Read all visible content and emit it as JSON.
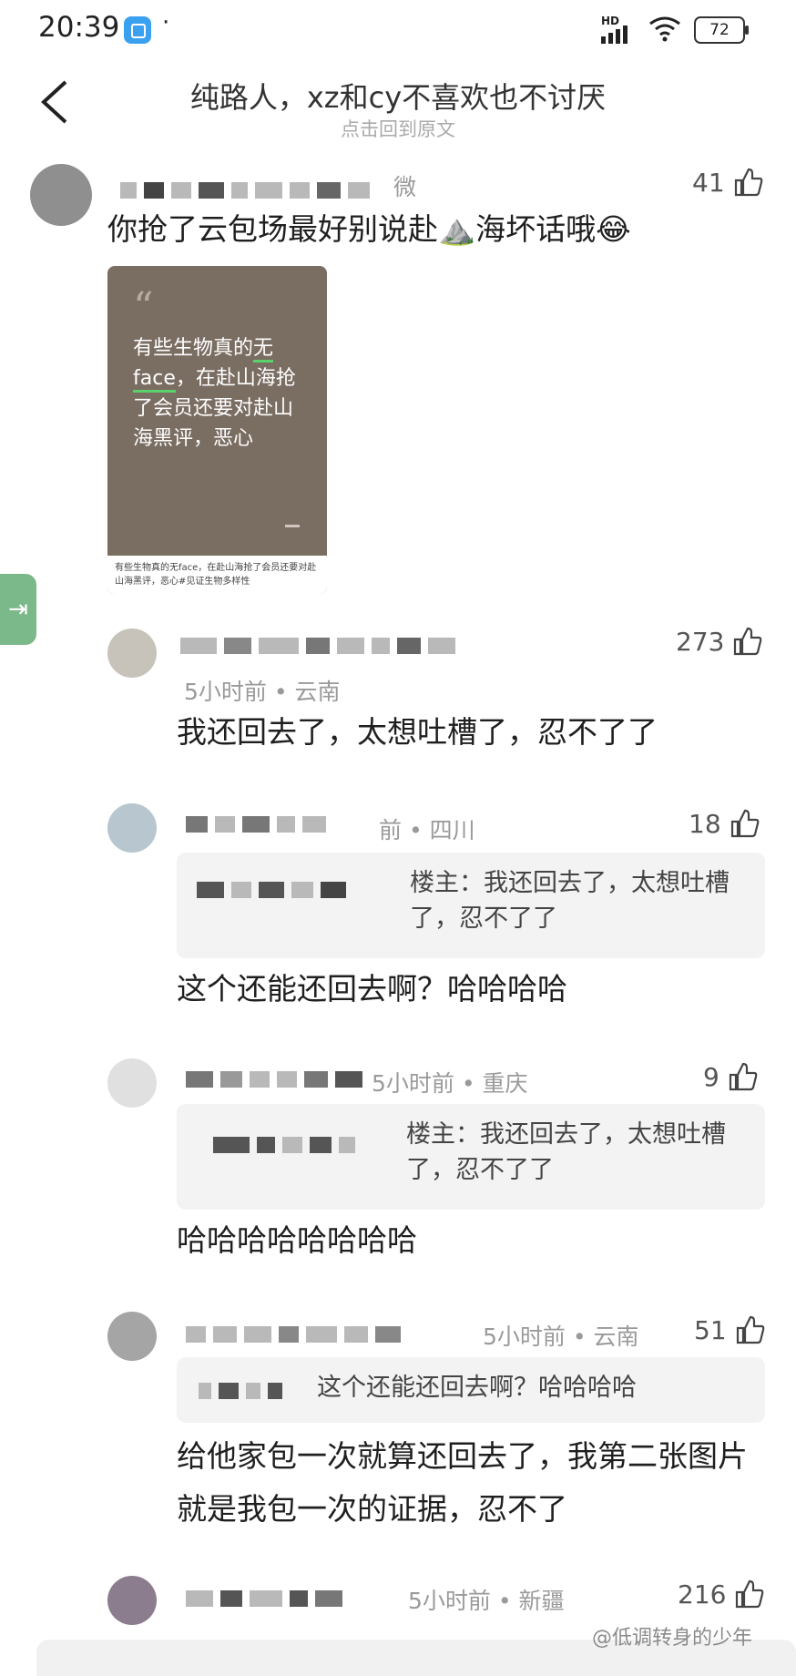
{
  "status_bar": {
    "time": "20:39",
    "dot": "·",
    "hd": "HD",
    "battery": "72"
  },
  "header": {
    "title": "纯路人，xz和cy不喜欢也不讨厌",
    "subtitle": "点击回到原文"
  },
  "main_comment": {
    "name_tail": "微",
    "likes": "41",
    "text": "你抢了云包场最好别说赴⛰️海坏话哦😂",
    "image_card": {
      "quote_mark": "“",
      "text_pre": "有些生物真的",
      "text_highlight": "无face",
      "text_post": "，在赴山海抢了会员还要对赴山海黑评，恶心",
      "caption": "有些生物真的无face，在赴山海抢了会员还要对赴山海黑评，恶心#见证生物多样性"
    }
  },
  "replies": [
    {
      "meta": "5小时前 • 云南",
      "likes": "273",
      "text": "我还回去了，太想吐槽了，忍不了了"
    },
    {
      "meta": "前 • 四川",
      "likes": "18",
      "quote_prefix": "楼主",
      "quote_text": "：我还回去了，太想吐槽了，忍不了了",
      "text": "这个还能还回去啊？哈哈哈哈"
    },
    {
      "meta": "5小时前 • 重庆",
      "likes": "9",
      "quote_prefix": "楼主",
      "quote_text": "：我还回去了，太想吐槽了，忍不了了",
      "text": "哈哈哈哈哈哈哈哈"
    },
    {
      "meta": "5小时前 • 云南",
      "likes": "51",
      "quote_text": "这个还能还回去啊？哈哈哈哈",
      "text": "给他家包一次就算还回去了，我第二张图片就是我包一次的证据，忍不了"
    },
    {
      "meta": "5小时前 • 新疆",
      "likes": "216"
    }
  ],
  "side_tab": {
    "icon": "exit-icon"
  },
  "watermark": "@低调转身的少年"
}
